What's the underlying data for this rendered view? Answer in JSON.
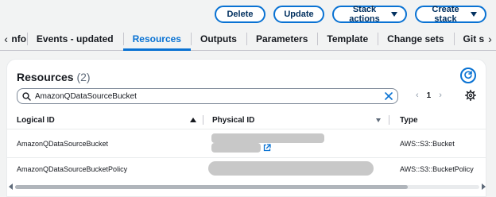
{
  "actions": {
    "delete": "Delete",
    "update": "Update",
    "stack_actions": "Stack actions",
    "create_stack": "Create stack"
  },
  "tabs": [
    {
      "label": "Info",
      "active": false
    },
    {
      "label": "Events - updated",
      "active": false
    },
    {
      "label": "Resources",
      "active": true
    },
    {
      "label": "Outputs",
      "active": false
    },
    {
      "label": "Parameters",
      "active": false
    },
    {
      "label": "Template",
      "active": false
    },
    {
      "label": "Change sets",
      "active": false
    },
    {
      "label": "Git sync",
      "active": false
    }
  ],
  "resources": {
    "title": "Resources",
    "count": "(2)",
    "search_value": "AmazonQDataSourceBucket",
    "page": "1",
    "columns": {
      "logical_id": "Logical ID",
      "physical_id": "Physical ID",
      "type": "Type"
    },
    "rows": [
      {
        "logical_id": "AmazonQDataSourceBucket",
        "type": "AWS::S3::Bucket"
      },
      {
        "logical_id": "AmazonQDataSourceBucketPolicy",
        "type": "AWS::S3::BucketPolicy"
      }
    ]
  },
  "icons": {
    "refresh": "refresh-icon",
    "search": "search-icon",
    "clear": "close-icon",
    "settings": "gear-icon",
    "external": "external-link-icon"
  },
  "colors": {
    "accent": "#0972d3",
    "button_text": "#033160",
    "text": "#16191f",
    "muted": "#5f6b7a",
    "redaction": "#c8c8c8"
  }
}
